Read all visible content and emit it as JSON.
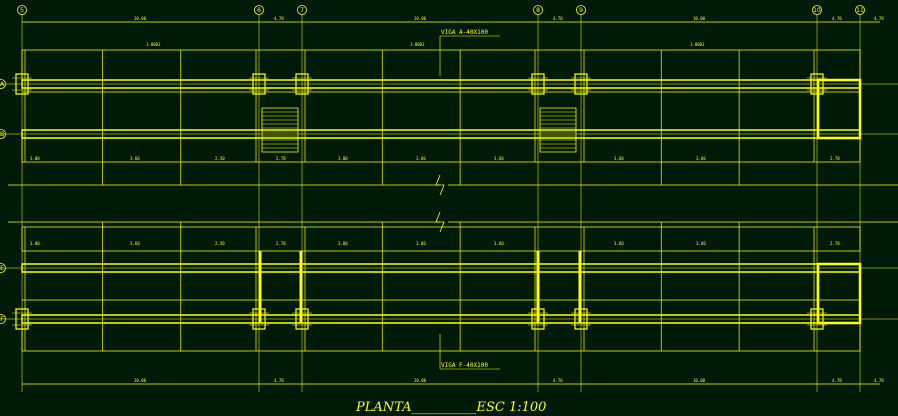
{
  "drawing": {
    "background": "#001a08",
    "line_color": "#ffff00",
    "title": "PLANTA__________ESC 1:100",
    "beam_top_label": "VIGA A-40X100",
    "beam_bottom_label": "VIGA F-40X100",
    "axis_top": [
      "5",
      "6",
      "7",
      "8",
      "9",
      "10",
      "11"
    ],
    "axis_left": [
      "A",
      "B",
      "E",
      "F"
    ],
    "dims_main": [
      "10.00",
      "4.70",
      "10.00",
      "4.70",
      "10.00",
      "4.70",
      "4.70"
    ],
    "dims_inner_top": [
      "1-0001",
      "1-0001",
      "1-0001"
    ],
    "dims_row": [
      "3.00",
      "3.60",
      "2.50",
      "2.70",
      "3.00",
      "3.60",
      "3.60",
      "3.60",
      "3.60",
      "2.70"
    ]
  }
}
